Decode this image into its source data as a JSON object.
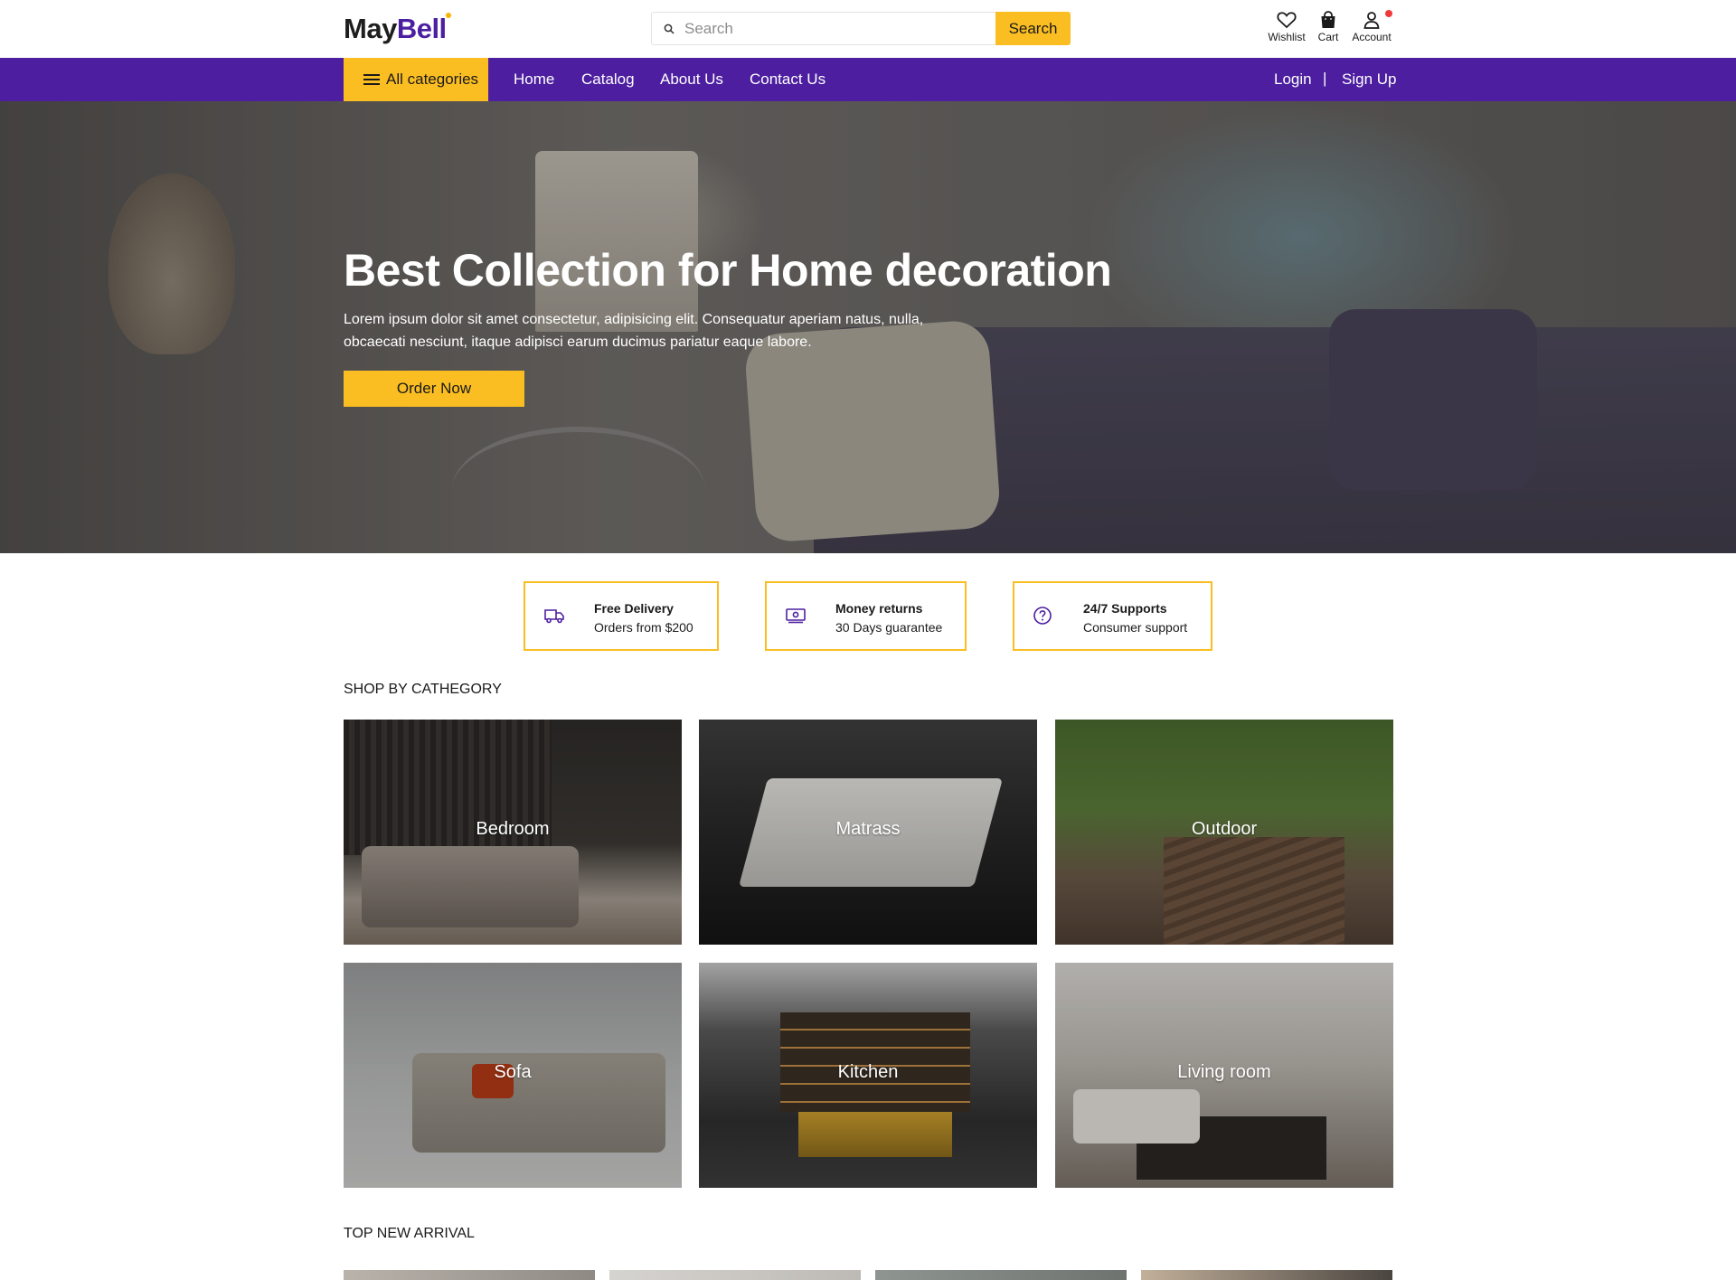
{
  "header": {
    "logo_part1": "May",
    "logo_part2": "Bell",
    "search_placeholder": "Search",
    "search_button": "Search",
    "wishlist_label": "Wishlist",
    "cart_label": "Cart",
    "account_label": "Account"
  },
  "nav": {
    "all_categories": "All categories",
    "links": [
      "Home",
      "Catalog",
      "About Us",
      "Contact Us"
    ],
    "login": "Login",
    "separator": "|",
    "signup": "Sign Up"
  },
  "hero": {
    "title": "Best Collection for Home decoration",
    "text": "Lorem ipsum dolor sit amet consectetur, adipisicing elit. Consequatur aperiam natus, nulla, obcaecati nesciunt, itaque adipisci earum ducimus pariatur eaque labore.",
    "button": "Order Now"
  },
  "features": [
    {
      "title": "Free Delivery",
      "subtitle": "Orders from $200",
      "icon": "truck-icon"
    },
    {
      "title": "Money returns",
      "subtitle": "30 Days guarantee",
      "icon": "money-icon"
    },
    {
      "title": "24/7 Supports",
      "subtitle": "Consumer support",
      "icon": "help-circle-icon"
    }
  ],
  "categories": {
    "title": "SHOP BY CATHEGORY",
    "items": [
      "Bedroom",
      "Matrass",
      "Outdoor",
      "Sofa",
      "Kitchen",
      "Living room"
    ]
  },
  "arrivals": {
    "title": "TOP NEW ARRIVAL"
  },
  "colors": {
    "brand_purple": "#4d1fa0",
    "accent_yellow": "#fbbe22",
    "notification_red": "#f03a3a"
  }
}
